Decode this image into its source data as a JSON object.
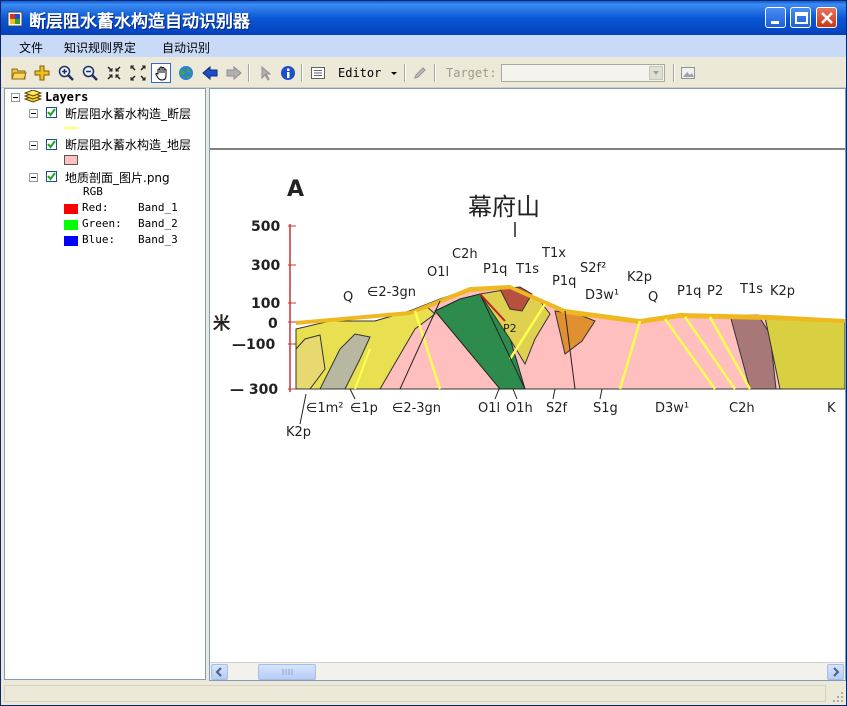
{
  "window": {
    "title": "断层阻水蓄水构造自动识别器",
    "colors": {
      "title_bar": "#0a58d6",
      "menu_bar": "#c9daf8",
      "close_button": "#c8361a"
    }
  },
  "menu": {
    "items": [
      "文件",
      "知识规则界定",
      "自动识别"
    ]
  },
  "toolbar": {
    "icons": [
      "open-folder-icon",
      "add-data-icon",
      "zoom-in-icon",
      "zoom-out-icon",
      "fixed-zoom-in-icon",
      "fixed-zoom-out-icon",
      "pan-hand-icon",
      "globe-full-extent-icon",
      "back-arrow-icon",
      "forward-arrow-icon",
      "select-arrow-icon",
      "identify-info-icon",
      "layout-view-icon",
      "pencil-sketch-icon",
      "image-icon"
    ],
    "editor_label": "Editor",
    "target_label": "Target:",
    "target_value": ""
  },
  "toc": {
    "root_label": "Layers",
    "layers": [
      {
        "name": "断层阻水蓄水构造_断层",
        "symbol": "line",
        "color": "#ffff66"
      },
      {
        "name": "断层阻水蓄水构造_地层",
        "symbol": "fill",
        "color": "#ffc0c0"
      },
      {
        "name": "地质剖面_图片.png",
        "symbol": "raster"
      }
    ],
    "raster_legend": {
      "title": "RGB",
      "bands": [
        {
          "channel": "Red:",
          "band": "Band_1",
          "color": "#ff0000"
        },
        {
          "channel": "Green:",
          "band": "Band_2",
          "color": "#00ff00"
        },
        {
          "channel": "Blue:",
          "band": "Band_3",
          "color": "#0000ff"
        }
      ]
    }
  },
  "map": {
    "section_letter": "A",
    "mountain_name": "幕府山",
    "unit_label": "米",
    "elevation_ticks": [
      "500",
      "300",
      "100",
      "0",
      "—100",
      "— 300"
    ],
    "top_labels": [
      "Q",
      "∈2-3gn",
      "O1l",
      "C2h",
      "P1q",
      "T1s",
      "T1x",
      "P1q",
      "S2f²",
      "D3w¹",
      "K2p",
      "Q",
      "P1q",
      "P2",
      "T1s",
      "K2p"
    ],
    "bottom_labels": [
      "∈1m²",
      "∈1p",
      "∈2-3gn",
      "O1l",
      "O1h",
      "S2f",
      "S1g",
      "D3w¹",
      "C2h",
      "K"
    ],
    "corner_label": "K2p",
    "inner_label": "P2"
  }
}
